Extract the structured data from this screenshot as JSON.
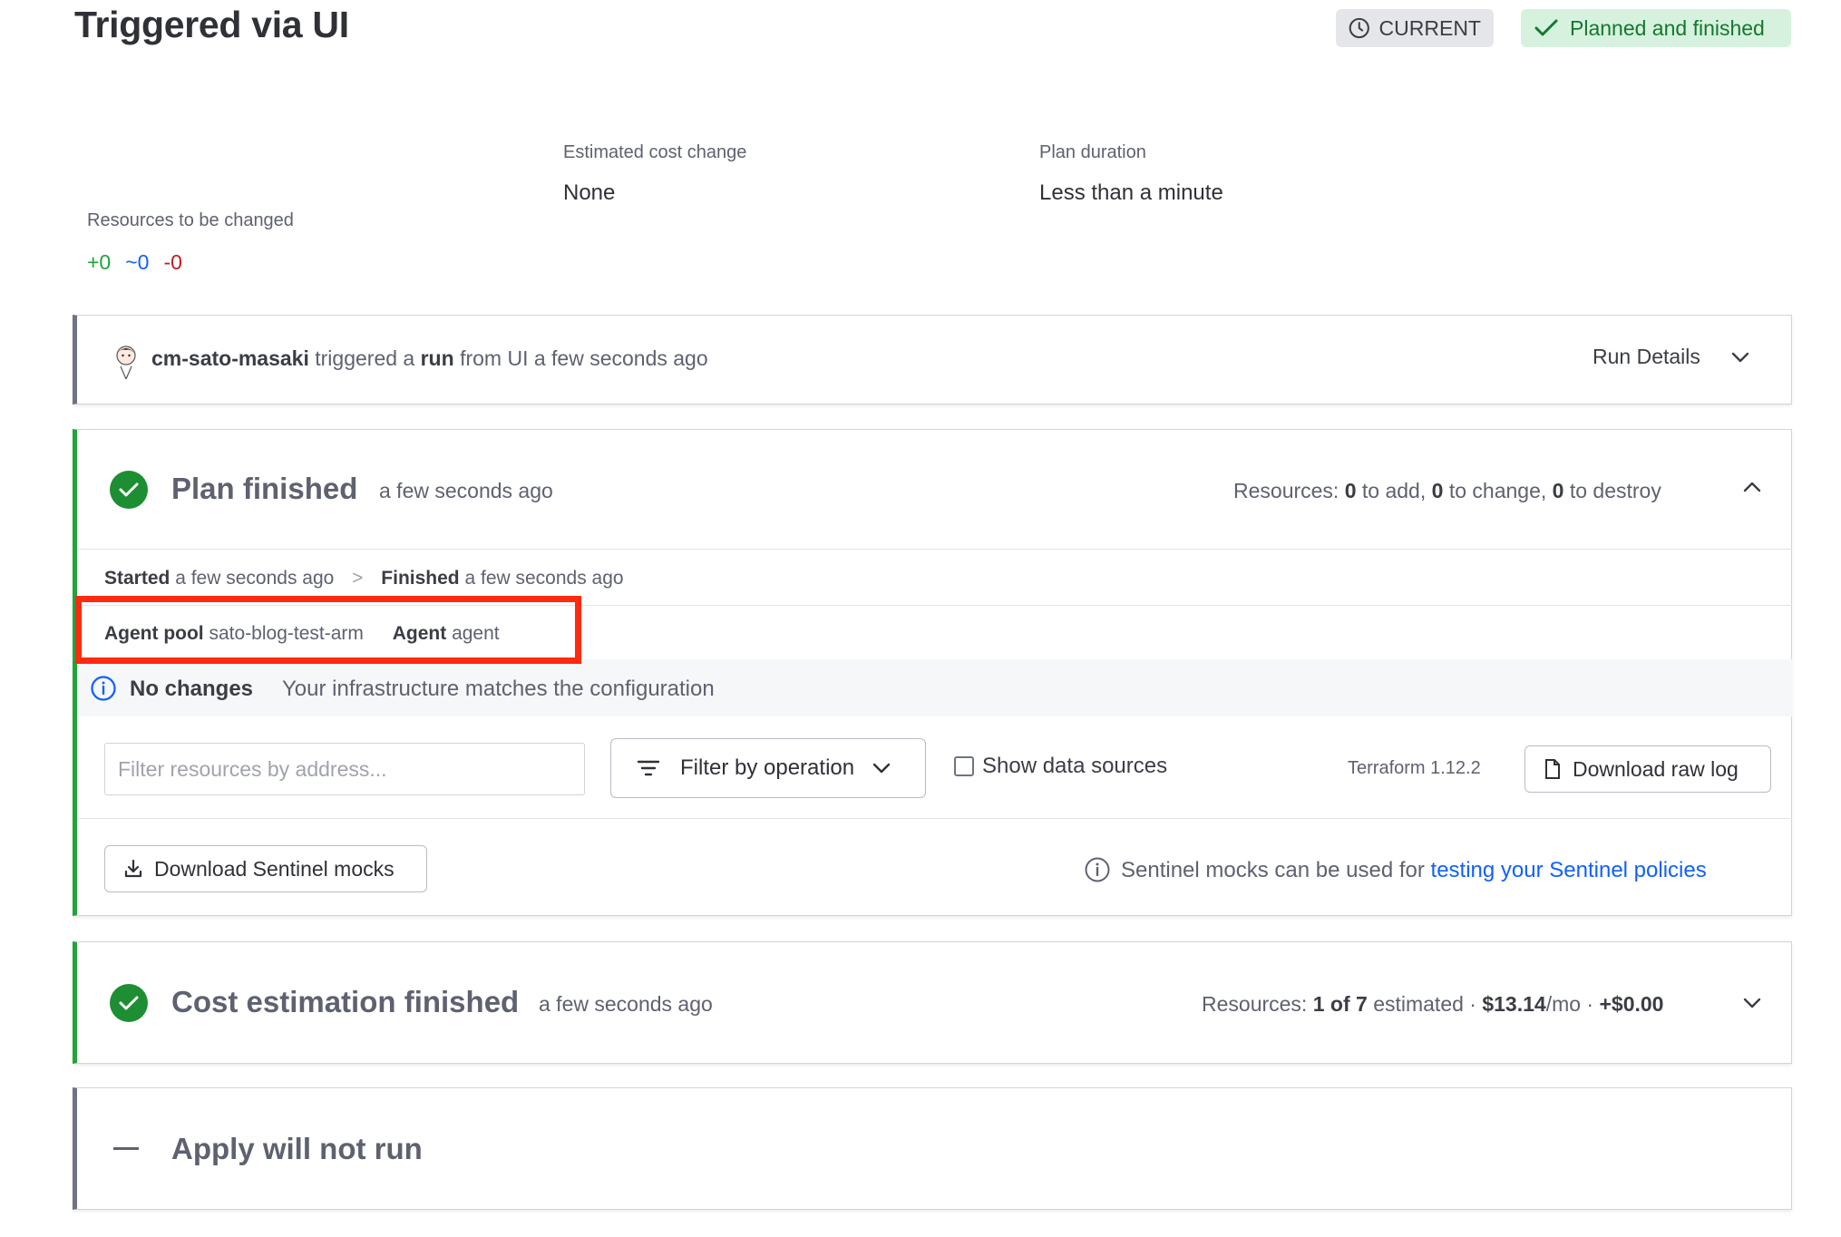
{
  "page": {
    "title": "Triggered via UI",
    "badges": {
      "current": "CURRENT",
      "planned": "Planned and finished"
    }
  },
  "summary": {
    "resources_label": "Resources to be changed",
    "add": "+0",
    "change": "~0",
    "destroy": "-0",
    "cost_label": "Estimated cost change",
    "cost_value": "None",
    "duration_label": "Plan duration",
    "duration_value": "Less than a minute"
  },
  "trigger": {
    "user": "cm-sato-masaki",
    "text1": "triggered a",
    "run": "run",
    "text2": "from UI a few seconds ago",
    "details": "Run Details"
  },
  "plan": {
    "title": "Plan finished",
    "time": "a few seconds ago",
    "resources_prefix": "Resources:",
    "add_count": "0",
    "add_text": "to add,",
    "change_count": "0",
    "change_text": "to change,",
    "destroy_count": "0",
    "destroy_text": "to destroy",
    "started_label": "Started",
    "started_value": "a few seconds ago",
    "separator": ">",
    "finished_label": "Finished",
    "finished_value": "a few seconds ago",
    "agent_pool_label": "Agent pool",
    "agent_pool_value": "sato-blog-test-arm",
    "agent_label": "Agent",
    "agent_value": "agent",
    "no_changes_label": "No changes",
    "no_changes_text": "Your infrastructure matches the configuration",
    "filter_placeholder": "Filter resources by address...",
    "filter_operation": "Filter by operation",
    "show_data_sources": "Show data sources",
    "terraform_version": "Terraform 1.12.2",
    "download_raw_log": "Download raw log",
    "download_sentinel": "Download Sentinel mocks",
    "sentinel_text": "Sentinel mocks can be used for",
    "sentinel_link": "testing your Sentinel policies"
  },
  "cost": {
    "title": "Cost estimation finished",
    "time": "a few seconds ago",
    "resources_prefix": "Resources:",
    "estimated_count": "1 of 7",
    "estimated_text": "estimated ·",
    "monthly": "$13.14",
    "per_month": "/mo ·",
    "delta": "+$0.00"
  },
  "apply": {
    "title": "Apply will not run"
  },
  "colors": {
    "success": "#1d8f32",
    "link": "#1060ff",
    "highlight": "#ff2a10",
    "add": "#21a33a",
    "change": "#1060ff",
    "destroy": "#c51a1a"
  }
}
